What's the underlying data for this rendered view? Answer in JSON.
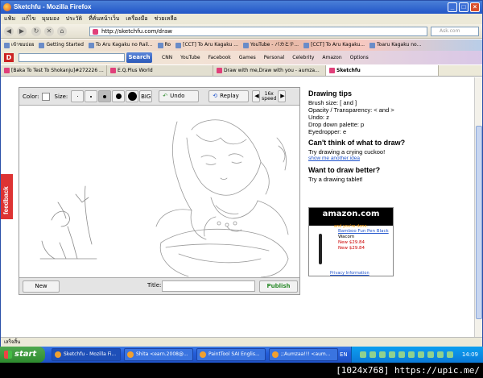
{
  "window": {
    "title": "Sketchfu - Mozilla Firefox",
    "minimize": "_",
    "maximize": "□",
    "close": "×"
  },
  "menu": [
    "แฟ้ม",
    "แก้ไข",
    "มุมมอง",
    "ประวัติ",
    "ที่คั่นหน้าเว็บ",
    "เครื่องมือ",
    "ช่วยเหลือ"
  ],
  "nav": {
    "url": "http://sketchfu.com/draw",
    "search_placeholder": "Ask.com"
  },
  "bookmarks": [
    "เข้าชมบ่อย",
    "Getting Started",
    "To Aru Kagaku no Rail...",
    "Ro",
    "[CCT] To Aru Kagaku ...",
    "YouTube - バカとテ...",
    "[CCT] To Aru Kagaku...",
    "Toaru Kagaku no..."
  ],
  "toolbar2": {
    "logo": "D",
    "search_button": "Search",
    "links": [
      "CNN",
      "YouTube",
      "Facebook",
      "Games",
      "Personal",
      "Celebrity",
      "Amazon",
      "Options"
    ]
  },
  "tabs": [
    "[Baka To Test To Shokanju]#272226 ...",
    "E.Q.Plus World",
    "Draw with me,Draw with you - aumza...",
    "Sketchfu"
  ],
  "feedback": "feedback",
  "draw": {
    "color_label": "Color:",
    "size_label": "Size:",
    "big_label": "BIG",
    "undo_label": "Undo",
    "replay_label": "Replay",
    "speed_label": "16x speed",
    "new_label": "New",
    "title_label": "Title:",
    "publish_label": "Publish"
  },
  "tips": {
    "heading": "Drawing tips",
    "lines": [
      "Brush size: [ and ]",
      "Opacity / Transparency: < and >",
      "Undo: z",
      "Drop down palette: p",
      "Eyedropper: e"
    ],
    "idea_heading": "Can't think of what to draw?",
    "idea_text": "Try drawing a crying cuckoo!",
    "idea_link": "show me another idea",
    "better_heading": "Want to draw better?",
    "better_text": "Try a drawing tablet!"
  },
  "ad": {
    "brand": "amazon.com",
    "tagline": "and you're done.",
    "product": "Bamboo Fun Pen Black",
    "maker": "Wacom",
    "price_new_1": "New $29.84",
    "price_new_2": "New $29.84",
    "privacy": "Privacy Information"
  },
  "status": "เสร็จสิ้น",
  "taskbar": {
    "start": "start",
    "tasks": [
      "Sketchfu - Mozilla Fi...",
      "Shita <earn.2008@...",
      "PaintTool SAI Englis...",
      ";;Aumzaa!!! <aum..."
    ],
    "lang": "EN",
    "clock": "14:09"
  },
  "watermark": "[1024x768] https://upic.me/"
}
